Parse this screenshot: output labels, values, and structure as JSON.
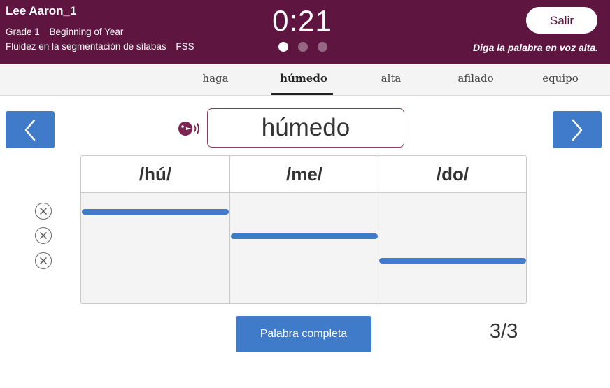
{
  "header": {
    "student_name": "Lee Aaron_1",
    "grade": "Grade 1",
    "period": "Beginning of Year",
    "assessment": "Fluidez en la segmentación de sílabas",
    "code": "FSS",
    "timer": "0:21",
    "exit_label": "Salir",
    "instruction": "Diga la palabra en voz alta.",
    "colors": {
      "background": "#5e1640",
      "text": "#ffffff"
    }
  },
  "progress_dots": {
    "total": 3,
    "active": 1
  },
  "word_tabs": [
    {
      "label": "haga",
      "active": false
    },
    {
      "label": "húmedo",
      "active": true
    },
    {
      "label": "alta",
      "active": false
    },
    {
      "label": "afilado",
      "active": false
    },
    {
      "label": "equipo",
      "active": false
    }
  ],
  "navigation": {
    "prev_icon": "chevron-left-icon",
    "next_icon": "chevron-right-icon",
    "color": "#3f7bc8"
  },
  "current_word": {
    "text": "húmedo",
    "audio_icon": "speaker-icon",
    "border_color": "#8b3a62"
  },
  "syllables": [
    "/hú/",
    "/me/",
    "/do/"
  ],
  "error_marks": {
    "count": 3,
    "icon": "close-icon"
  },
  "complete_button_label": "Palabra completa",
  "counter": "3/3",
  "accent_color": "#3f7bc8"
}
